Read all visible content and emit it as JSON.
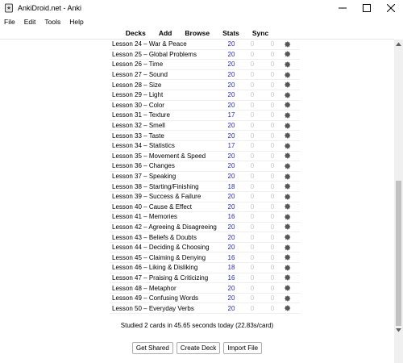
{
  "window": {
    "title": "AnkiDroid.net - Anki"
  },
  "menu": [
    "File",
    "Edit",
    "Tools",
    "Help"
  ],
  "toolbar": {
    "decks": "Decks",
    "add": "Add",
    "browse": "Browse",
    "stats": "Stats",
    "sync": "Sync"
  },
  "decks": [
    {
      "name": "Lesson 24 – War & Peace",
      "new": "20",
      "learn": "0",
      "due": "0"
    },
    {
      "name": "Lesson 25 – Global Problems",
      "new": "20",
      "learn": "0",
      "due": "0"
    },
    {
      "name": "Lesson 26 – Time",
      "new": "20",
      "learn": "0",
      "due": "0"
    },
    {
      "name": "Lesson 27 – Sound",
      "new": "20",
      "learn": "0",
      "due": "0"
    },
    {
      "name": "Lesson 28 – Size",
      "new": "20",
      "learn": "0",
      "due": "0"
    },
    {
      "name": "Lesson 29 – Light",
      "new": "20",
      "learn": "0",
      "due": "0"
    },
    {
      "name": "Lesson 30 – Color",
      "new": "20",
      "learn": "0",
      "due": "0"
    },
    {
      "name": "Lesson 31 – Texture",
      "new": "17",
      "learn": "0",
      "due": "0"
    },
    {
      "name": "Lesson 32 – Smell",
      "new": "20",
      "learn": "0",
      "due": "0"
    },
    {
      "name": "Lesson 33 – Taste",
      "new": "20",
      "learn": "0",
      "due": "0"
    },
    {
      "name": "Lesson 34 – Statistics",
      "new": "17",
      "learn": "0",
      "due": "0"
    },
    {
      "name": "Lesson 35 – Movement & Speed",
      "new": "20",
      "learn": "0",
      "due": "0"
    },
    {
      "name": "Lesson 36 – Changes",
      "new": "20",
      "learn": "0",
      "due": "0"
    },
    {
      "name": "Lesson 37 – Speaking",
      "new": "20",
      "learn": "0",
      "due": "0"
    },
    {
      "name": "Lesson 38 – Starting/Finishing",
      "new": "18",
      "learn": "0",
      "due": "0"
    },
    {
      "name": "Lesson 39 – Success & Failure",
      "new": "20",
      "learn": "0",
      "due": "0"
    },
    {
      "name": "Lesson 40 – Cause & Effect",
      "new": "20",
      "learn": "0",
      "due": "0"
    },
    {
      "name": "Lesson 41 – Memories",
      "new": "16",
      "learn": "0",
      "due": "0"
    },
    {
      "name": "Lesson 42 – Agreeing & Disagreeing",
      "new": "20",
      "learn": "0",
      "due": "0"
    },
    {
      "name": "Lesson 43 – Beliefs & Doubts",
      "new": "20",
      "learn": "0",
      "due": "0"
    },
    {
      "name": "Lesson 44 – Deciding & Choosing",
      "new": "20",
      "learn": "0",
      "due": "0"
    },
    {
      "name": "Lesson 45 – Claiming & Denying",
      "new": "16",
      "learn": "0",
      "due": "0"
    },
    {
      "name": "Lesson 46 – Liking & Disliking",
      "new": "18",
      "learn": "0",
      "due": "0"
    },
    {
      "name": "Lesson 47 – Praising & Criticizing",
      "new": "16",
      "learn": "0",
      "due": "0"
    },
    {
      "name": "Lesson 48 – Metaphor",
      "new": "20",
      "learn": "0",
      "due": "0"
    },
    {
      "name": "Lesson 49 – Confusing Words",
      "new": "20",
      "learn": "0",
      "due": "0"
    },
    {
      "name": "Lesson 50 – Everyday Verbs",
      "new": "20",
      "learn": "0",
      "due": "0"
    }
  ],
  "studied": "Studied 2 cards in 45.65 seconds today (22.83s/card)",
  "buttons": {
    "get_shared": "Get Shared",
    "create_deck": "Create Deck",
    "import_file": "Import File"
  },
  "colors": {
    "new_count": "#2a2ac0",
    "zero_count": "#c8c8c8"
  }
}
